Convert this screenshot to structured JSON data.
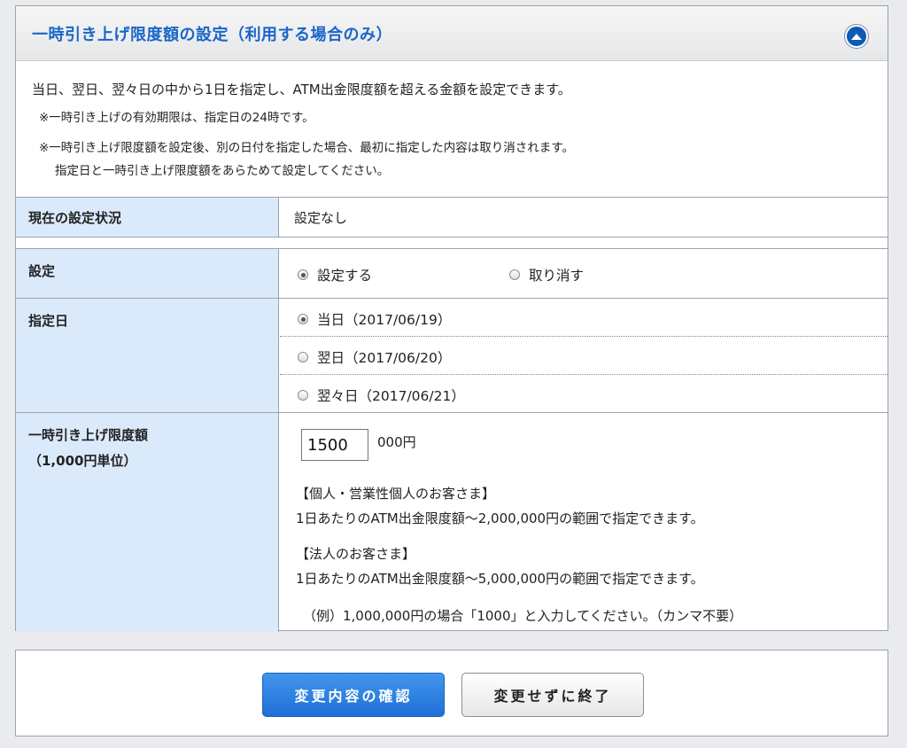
{
  "panel": {
    "title": "一時引き上げ限度額の設定（利用する場合のみ）",
    "intro": "当日、翌日、翌々日の中から1日を指定し、ATM出金限度額を超える金額を設定できます。",
    "note1": "※一時引き上げの有効期限は、指定日の24時です。",
    "note2": "※一時引き上げ限度額を設定後、別の日付を指定した場合、最初に指定した内容は取り消されます。",
    "note3": "指定日と一時引き上げ限度額をあらためて設定してください。"
  },
  "status": {
    "label": "現在の設定状況",
    "value": "設定なし"
  },
  "setting": {
    "label": "設定",
    "options": [
      {
        "label": "設定する",
        "checked": true
      },
      {
        "label": "取り消す",
        "checked": false
      }
    ]
  },
  "date": {
    "label": "指定日",
    "options": [
      {
        "label": "当日（2017/06/19）",
        "checked": true
      },
      {
        "label": "翌日（2017/06/20）",
        "checked": false
      },
      {
        "label": "翌々日（2017/06/21）",
        "checked": false
      }
    ]
  },
  "amount": {
    "label_line1": "一時引き上げ限度額",
    "label_line2": "（1,000円単位）",
    "value": "1500",
    "unit": "000円",
    "personal_heading": "【個人・営業性個人のお客さま】",
    "personal_text": "1日あたりのATM出金限度額～2,000,000円の範囲で指定できます。",
    "corporate_heading": "【法人のお客さま】",
    "corporate_text": "1日あたりのATM出金限度額～5,000,000円の範囲で指定できます。",
    "example": "（例）1,000,000円の場合「1000」と入力してください。（カンマ不要）"
  },
  "buttons": {
    "confirm": "変更内容の確認",
    "exit": "変更せずに終了"
  },
  "colors": {
    "title": "#1a66c9",
    "label_bg": "#dbeafb",
    "primary": "#1f6fd6"
  },
  "icons": {
    "collapse": "chevron-up-icon"
  }
}
